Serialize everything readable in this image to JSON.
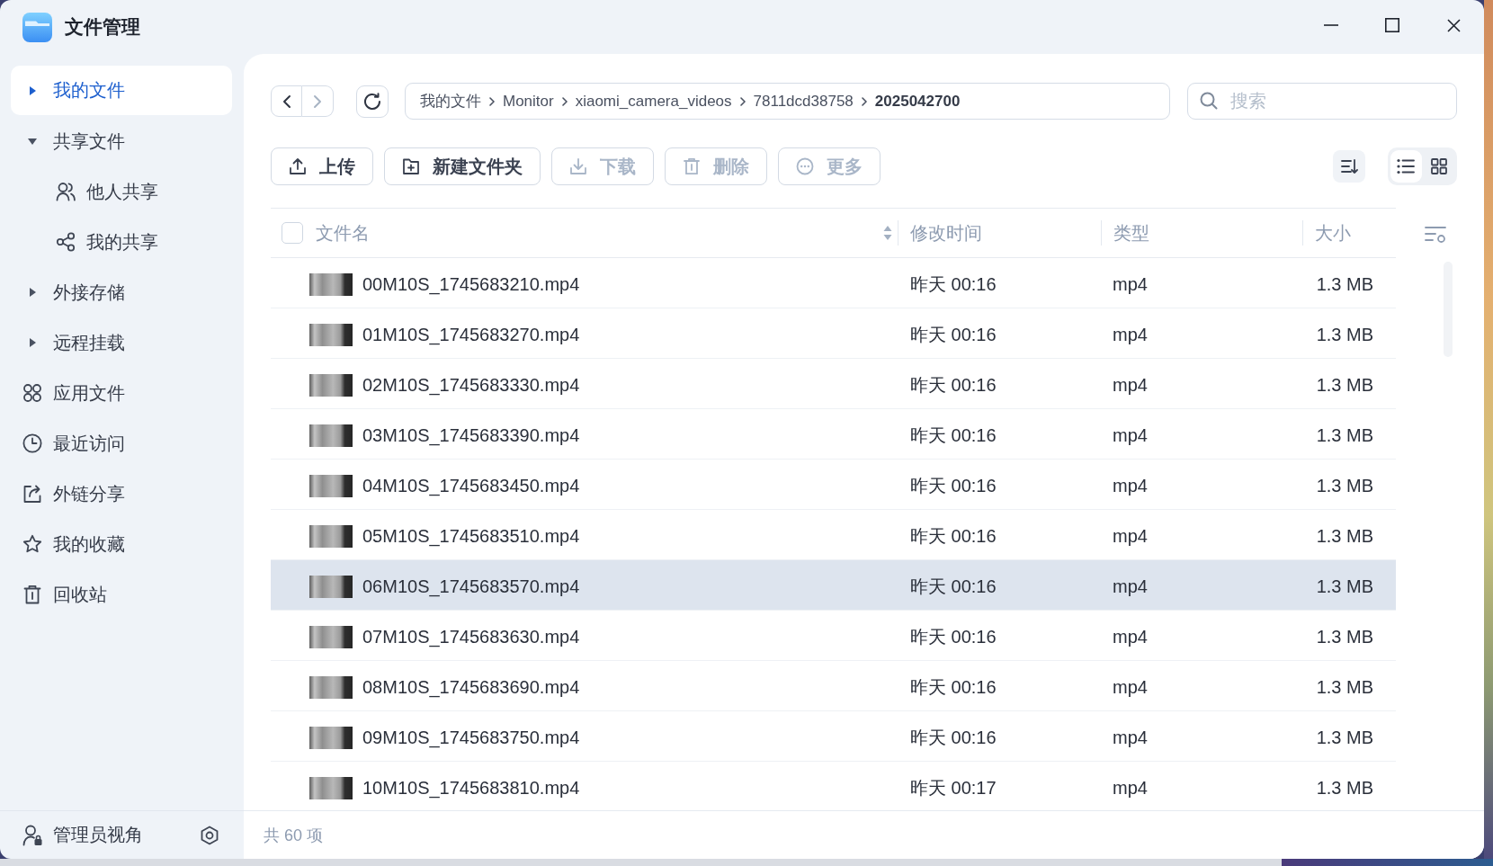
{
  "window": {
    "title": "文件管理"
  },
  "sidebar": {
    "items": [
      {
        "kind": "group",
        "label": "我的文件",
        "selected": true,
        "expanded": false
      },
      {
        "kind": "group",
        "label": "共享文件",
        "selected": false,
        "expanded": true,
        "children": [
          {
            "kind": "link",
            "label": "他人共享",
            "selected": false
          },
          {
            "kind": "link",
            "label": "我的共享",
            "selected": false
          }
        ]
      },
      {
        "kind": "group",
        "label": "外接存储",
        "selected": false,
        "expanded": false
      },
      {
        "kind": "group",
        "label": "远程挂载",
        "selected": false,
        "expanded": false
      },
      {
        "kind": "link",
        "label": "应用文件",
        "selected": false
      },
      {
        "kind": "link",
        "label": "最近访问",
        "selected": false
      },
      {
        "kind": "link",
        "label": "外链分享",
        "selected": false
      },
      {
        "kind": "link",
        "label": "我的收藏",
        "selected": false
      },
      {
        "kind": "link",
        "label": "回收站",
        "selected": false
      }
    ],
    "footer": {
      "label": "管理员视角"
    }
  },
  "navigation": {
    "buttons": [
      {
        "disabled": false
      },
      {
        "disabled": true
      }
    ],
    "breadcrumb": [
      "我的文件",
      "Monitor",
      "xiaomi_camera_videos",
      "7811dcd38758",
      "2025042700"
    ]
  },
  "search": {
    "placeholder": "搜索"
  },
  "toolbar": {
    "buttons": [
      {
        "label": "上传",
        "disabled": false
      },
      {
        "label": "新建文件夹",
        "disabled": false
      },
      {
        "label": "下载",
        "disabled": true
      },
      {
        "label": "删除",
        "disabled": true
      },
      {
        "label": "更多",
        "disabled": true
      }
    ],
    "view_modes": [
      {
        "selected": true
      },
      {
        "selected": false
      }
    ]
  },
  "table": {
    "select_all": {
      "checked": false
    },
    "columns": [
      "文件名",
      "修改时间",
      "类型",
      "大小"
    ],
    "rows": [
      {
        "name": "00M10S_1745683210.mp4",
        "modified": "昨天 00:16",
        "type": "mp4",
        "size": "1.3 MB",
        "selected": false
      },
      {
        "name": "01M10S_1745683270.mp4",
        "modified": "昨天 00:16",
        "type": "mp4",
        "size": "1.3 MB",
        "selected": false
      },
      {
        "name": "02M10S_1745683330.mp4",
        "modified": "昨天 00:16",
        "type": "mp4",
        "size": "1.3 MB",
        "selected": false
      },
      {
        "name": "03M10S_1745683390.mp4",
        "modified": "昨天 00:16",
        "type": "mp4",
        "size": "1.3 MB",
        "selected": false
      },
      {
        "name": "04M10S_1745683450.mp4",
        "modified": "昨天 00:16",
        "type": "mp4",
        "size": "1.3 MB",
        "selected": false
      },
      {
        "name": "05M10S_1745683510.mp4",
        "modified": "昨天 00:16",
        "type": "mp4",
        "size": "1.3 MB",
        "selected": false
      },
      {
        "name": "06M10S_1745683570.mp4",
        "modified": "昨天 00:16",
        "type": "mp4",
        "size": "1.3 MB",
        "selected": true
      },
      {
        "name": "07M10S_1745683630.mp4",
        "modified": "昨天 00:16",
        "type": "mp4",
        "size": "1.3 MB",
        "selected": false
      },
      {
        "name": "08M10S_1745683690.mp4",
        "modified": "昨天 00:16",
        "type": "mp4",
        "size": "1.3 MB",
        "selected": false
      },
      {
        "name": "09M10S_1745683750.mp4",
        "modified": "昨天 00:16",
        "type": "mp4",
        "size": "1.3 MB",
        "selected": false
      },
      {
        "name": "10M10S_1745683810.mp4",
        "modified": "昨天 00:17",
        "type": "mp4",
        "size": "1.3 MB",
        "selected": false
      }
    ]
  },
  "status_bar": {
    "count": "共 60 项"
  }
}
